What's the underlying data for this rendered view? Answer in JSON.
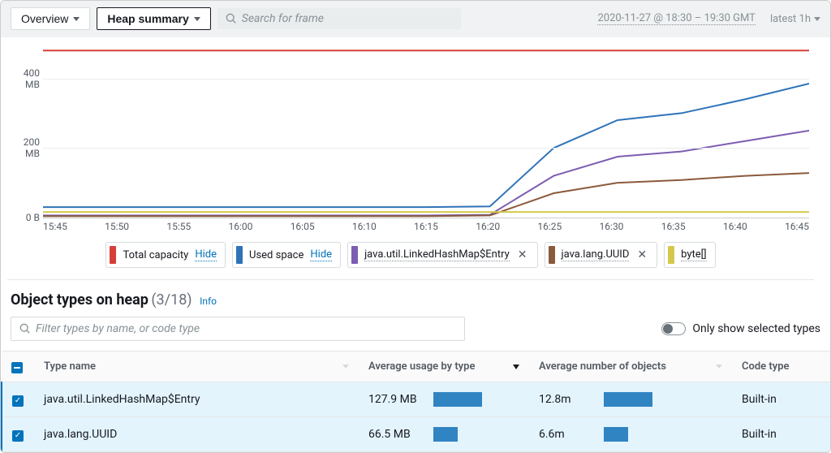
{
  "toolbar": {
    "overview_label": "Overview",
    "heap_summary_label": "Heap summary",
    "search_placeholder": "Search for frame",
    "time_range": "2020-11-27 @ 18:30 – 19:30 GMT",
    "latest": "latest 1h"
  },
  "chart_data": {
    "type": "line",
    "x": [
      "15:45",
      "15:50",
      "15:55",
      "16:00",
      "16:05",
      "16:10",
      "16:15",
      "16:20",
      "16:25",
      "16:30",
      "16:35",
      "16:40",
      "16:45"
    ],
    "ylabel": "",
    "ylim": [
      0,
      490
    ],
    "yticks": [
      {
        "v": 0,
        "label": "0 B"
      },
      {
        "v": 200,
        "label": "200 MB"
      },
      {
        "v": 400,
        "label": "400 MB"
      }
    ],
    "series": [
      {
        "name": "Total capacity",
        "color": "#d63f38",
        "values": [
          480,
          480,
          480,
          480,
          480,
          480,
          480,
          480,
          480,
          480,
          480,
          480,
          480
        ]
      },
      {
        "name": "Used space",
        "color": "#2e73b8",
        "values": [
          30,
          30,
          30,
          30,
          30,
          30,
          30,
          32,
          200,
          280,
          300,
          340,
          385
        ]
      },
      {
        "name": "java.util.LinkedHashMap$Entry",
        "color": "#7d5db2",
        "values": [
          6,
          6,
          6,
          6,
          6,
          6,
          6,
          8,
          120,
          175,
          190,
          220,
          250
        ]
      },
      {
        "name": "java.lang.UUID",
        "color": "#8b5a3c",
        "values": [
          4,
          4,
          4,
          4,
          4,
          4,
          4,
          6,
          70,
          100,
          108,
          120,
          128
        ]
      },
      {
        "name": "byte[]",
        "color": "#d4c94a",
        "values": [
          16,
          16,
          16,
          16,
          16,
          16,
          16,
          16,
          16,
          16,
          16,
          16,
          16
        ]
      }
    ]
  },
  "legend": {
    "total": {
      "label": "Total capacity",
      "action": "Hide",
      "color": "#d63f38"
    },
    "used": {
      "label": "Used space",
      "action": "Hide",
      "color": "#2e73b8"
    },
    "linkedhashmap": {
      "label": "java.util.LinkedHashMap$Entry",
      "color": "#7d5db2"
    },
    "uuid": {
      "label": "java.lang.UUID",
      "color": "#8b5a3c"
    },
    "bytes": {
      "label": "byte[]",
      "color": "#d4c94a"
    }
  },
  "section": {
    "title": "Object types on heap",
    "count": "(3/18)",
    "info_label": "Info",
    "filter_placeholder": "Filter types by name, or code type",
    "toggle_label": "Only show selected types"
  },
  "table": {
    "columns": {
      "type_name": "Type name",
      "avg_usage": "Average usage by type",
      "avg_objects": "Average number of objects",
      "code_type": "Code type"
    },
    "rows": [
      {
        "name": "java.util.LinkedHashMap$Entry",
        "usage": "127.9 MB",
        "usage_bar": 60,
        "objects": "12.8m",
        "objects_bar": 60,
        "code_type": "Built-in"
      },
      {
        "name": "java.lang.UUID",
        "usage": "66.5 MB",
        "usage_bar": 30,
        "objects": "6.6m",
        "objects_bar": 30,
        "code_type": "Built-in"
      }
    ]
  }
}
